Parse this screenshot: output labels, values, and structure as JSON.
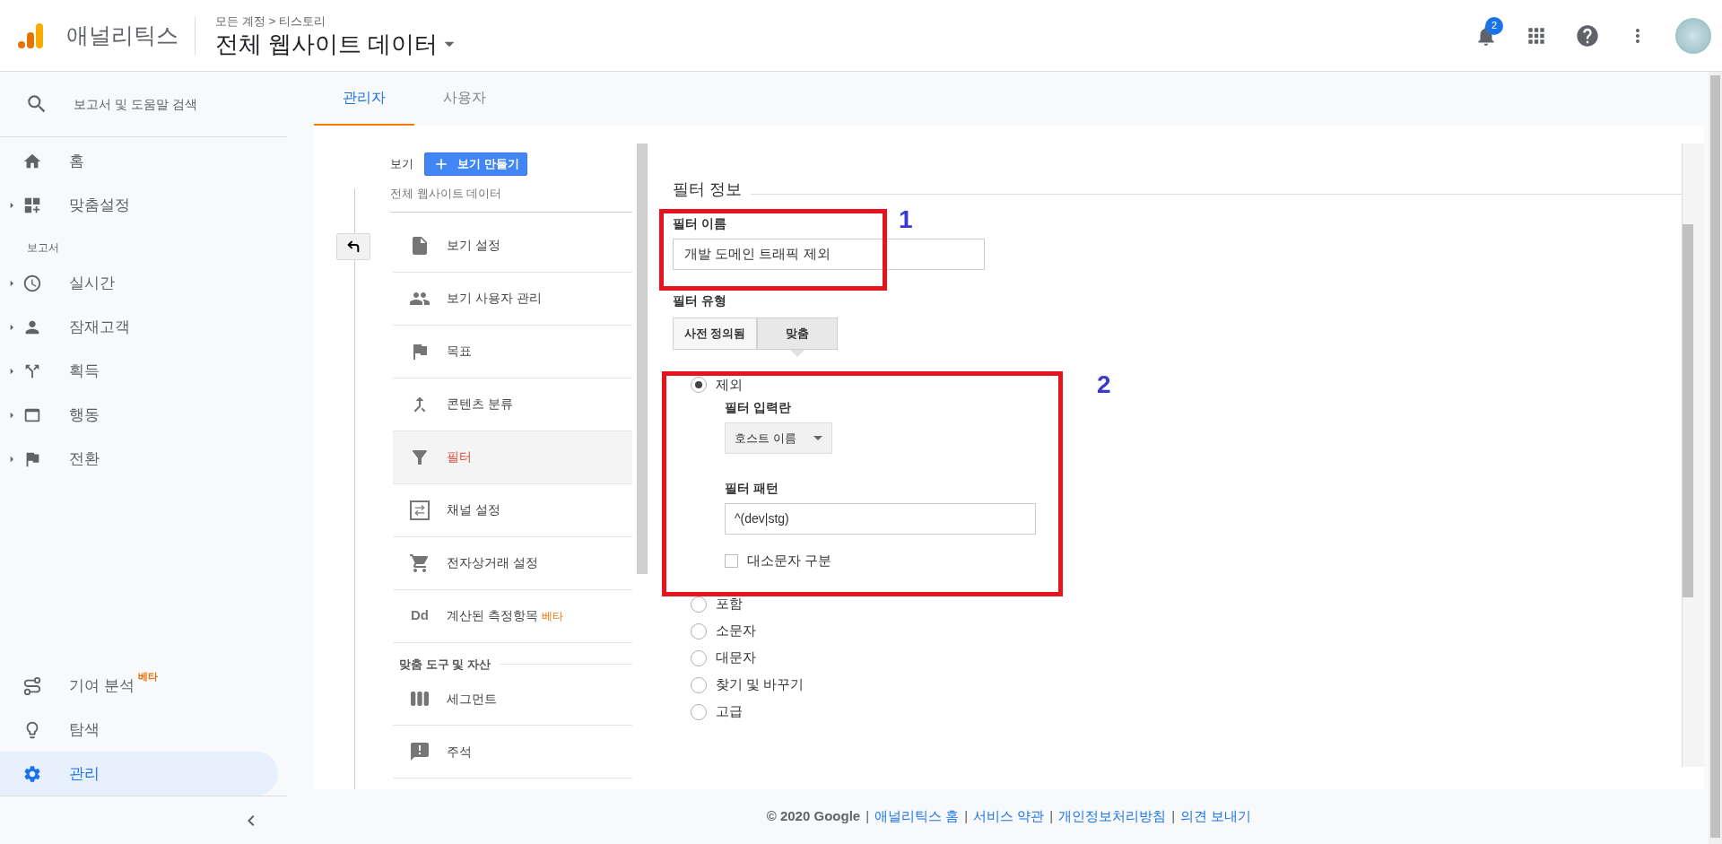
{
  "header": {
    "app_name": "애널리틱스",
    "breadcrumb": {
      "items": [
        "모든 계정",
        "티스토리"
      ],
      "separator": ">"
    },
    "title": "전체 웹사이트 데이터",
    "notification_count": "2"
  },
  "sidebar": {
    "search_placeholder": "보고서 및 도움말 검색",
    "top_items": [
      {
        "label": "홈",
        "expandable": false,
        "selected": false
      },
      {
        "label": "맞춤설정",
        "expandable": true,
        "selected": false
      }
    ],
    "section_label": "보고서",
    "report_items": [
      {
        "label": "실시간",
        "expandable": true,
        "selected": false
      },
      {
        "label": "잠재고객",
        "expandable": true,
        "selected": false
      },
      {
        "label": "획득",
        "expandable": true,
        "selected": false
      },
      {
        "label": "행동",
        "expandable": true,
        "selected": false
      },
      {
        "label": "전환",
        "expandable": true,
        "selected": false
      }
    ],
    "bottom_items": [
      {
        "label": "기여 분석",
        "badge": "베타",
        "selected": false
      },
      {
        "label": "탐색",
        "selected": false
      },
      {
        "label": "관리",
        "selected": true
      }
    ]
  },
  "tabs": [
    {
      "label": "관리자",
      "selected": true
    },
    {
      "label": "사용자",
      "selected": false
    }
  ],
  "view_column": {
    "label": "보기",
    "create_button": "보기 만들기",
    "view_name": "전체 웹사이트 데이터",
    "items": [
      {
        "label": "보기 설정",
        "selected": false
      },
      {
        "label": "보기 사용자 관리",
        "selected": false
      },
      {
        "label": "목표",
        "selected": false
      },
      {
        "label": "콘텐츠 분류",
        "selected": false
      },
      {
        "label": "필터",
        "selected": true
      },
      {
        "label": "채널 설정",
        "selected": false
      },
      {
        "label": "전자상거래 설정",
        "selected": false
      },
      {
        "label": "계산된 측정항목",
        "badge": "베타",
        "icon_text": "Dd",
        "selected": false
      }
    ],
    "tools_section": "맞춤 도구 및 자산",
    "tool_items": [
      {
        "label": "세그먼트"
      },
      {
        "label": "주석"
      }
    ]
  },
  "filter_form": {
    "section_title": "필터 정보",
    "name_label": "필터 이름",
    "name_value": "개발 도메인 트래픽 제외",
    "type_label": "필터 유형",
    "type_buttons": [
      {
        "label": "사전 정의됨",
        "selected": false
      },
      {
        "label": "맞춤",
        "selected": true
      }
    ],
    "options": [
      {
        "label": "제외",
        "selected": true
      },
      {
        "label": "포함",
        "selected": false
      },
      {
        "label": "소문자",
        "selected": false
      },
      {
        "label": "대문자",
        "selected": false
      },
      {
        "label": "찾기 및 바꾸기",
        "selected": false
      },
      {
        "label": "고급",
        "selected": false
      }
    ],
    "field_label": "필터 입력란",
    "field_dropdown": "호스트 이름",
    "pattern_label": "필터 패턴",
    "pattern_value": "^(dev|stg)",
    "case_label": "대소문자 구분",
    "case_checked": false
  },
  "annotations": [
    {
      "number": "1"
    },
    {
      "number": "2"
    }
  ],
  "footer": {
    "copyright": "© 2020 Google",
    "separator": "|",
    "links": [
      "애널리틱스 홈",
      "서비스 약관",
      "개인정보처리방침",
      "의견 보내기"
    ]
  }
}
